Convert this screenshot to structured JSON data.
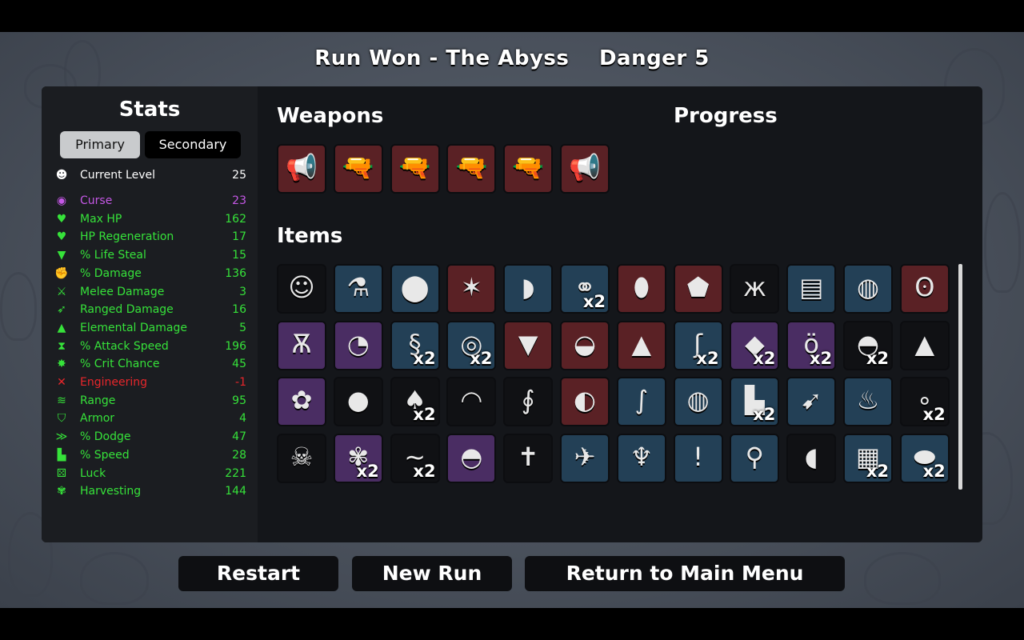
{
  "header": {
    "run_result": "Run Won - The Abyss",
    "danger": "Danger 5"
  },
  "stats": {
    "title": "Stats",
    "tabs": {
      "primary": "Primary",
      "secondary": "Secondary"
    },
    "rows": [
      {
        "icon": "level-up-icon",
        "glyph": "☻",
        "label": "Current Level",
        "value": "25",
        "color": "#ffffff"
      },
      {
        "icon": "curse-icon",
        "glyph": "◉",
        "label": "Curse",
        "value": "23",
        "color": "#c558e6"
      },
      {
        "icon": "heart-icon",
        "glyph": "♥",
        "label": "Max HP",
        "value": "162",
        "color": "#36e23a"
      },
      {
        "icon": "heart-plus-icon",
        "glyph": "♥",
        "label": "HP Regeneration",
        "value": "17",
        "color": "#36e23a"
      },
      {
        "icon": "fangs-icon",
        "glyph": "▼",
        "label": "% Life Steal",
        "value": "15",
        "color": "#36e23a"
      },
      {
        "icon": "muscle-icon",
        "glyph": "✊",
        "label": "% Damage",
        "value": "136",
        "color": "#36e23a"
      },
      {
        "icon": "sword-icon",
        "glyph": "⚔",
        "label": "Melee Damage",
        "value": "3",
        "color": "#36e23a"
      },
      {
        "icon": "bow-icon",
        "glyph": "➶",
        "label": "Ranged Damage",
        "value": "16",
        "color": "#36e23a"
      },
      {
        "icon": "flame-icon",
        "glyph": "▲",
        "label": "Elemental Damage",
        "value": "5",
        "color": "#36e23a"
      },
      {
        "icon": "hourglass-icon",
        "glyph": "⧗",
        "label": "% Attack Speed",
        "value": "196",
        "color": "#36e23a"
      },
      {
        "icon": "crit-star-icon",
        "glyph": "✸",
        "label": "% Crit Chance",
        "value": "45",
        "color": "#36e23a"
      },
      {
        "icon": "wrench-icon",
        "glyph": "✕",
        "label": "Engineering",
        "value": "-1",
        "color": "#e8262b"
      },
      {
        "icon": "range-waves-icon",
        "glyph": "≋",
        "label": "Range",
        "value": "95",
        "color": "#36e23a"
      },
      {
        "icon": "shield-icon",
        "glyph": "⛉",
        "label": "Armor",
        "value": "4",
        "color": "#36e23a"
      },
      {
        "icon": "dodge-wind-icon",
        "glyph": "≫",
        "label": "% Dodge",
        "value": "47",
        "color": "#36e23a"
      },
      {
        "icon": "boot-icon",
        "glyph": "▙",
        "label": "% Speed",
        "value": "28",
        "color": "#36e23a"
      },
      {
        "icon": "dice-icon",
        "glyph": "⚄",
        "label": "Luck",
        "value": "221",
        "color": "#36e23a"
      },
      {
        "icon": "wheat-icon",
        "glyph": "✾",
        "label": "Harvesting",
        "value": "144",
        "color": "#36e23a"
      }
    ]
  },
  "weapons": {
    "title": "Weapons",
    "slots": [
      {
        "name": "megaphone-icon",
        "glyph": "📢",
        "tier": "red"
      },
      {
        "name": "revolver-icon",
        "glyph": "🔫",
        "tier": "red"
      },
      {
        "name": "revolver-icon",
        "glyph": "🔫",
        "tier": "red"
      },
      {
        "name": "blunderbuss-icon",
        "glyph": "🔫",
        "tier": "red"
      },
      {
        "name": "blunderbuss-icon",
        "glyph": "🔫",
        "tier": "red"
      },
      {
        "name": "megaphone-icon",
        "glyph": "📢",
        "tier": "red"
      }
    ]
  },
  "progress": {
    "title": "Progress"
  },
  "items": {
    "title": "Items",
    "slots": [
      {
        "name": "mad-scientist-icon",
        "glyph": "☺",
        "tier": "black",
        "qty": ""
      },
      {
        "name": "potion-icon",
        "glyph": "⚗",
        "tier": "blue",
        "qty": ""
      },
      {
        "name": "bombs-icon",
        "glyph": "⬤",
        "tier": "blue",
        "qty": ""
      },
      {
        "name": "sparkler-icon",
        "glyph": "✶",
        "tier": "red",
        "qty": ""
      },
      {
        "name": "claw-icon",
        "glyph": "◗",
        "tier": "blue",
        "qty": ""
      },
      {
        "name": "chain-icon",
        "glyph": "⚭",
        "tier": "blue",
        "qty": "x2"
      },
      {
        "name": "potato-icon",
        "glyph": "⬮",
        "tier": "red",
        "qty": ""
      },
      {
        "name": "red-bag-icon",
        "glyph": "⬟",
        "tier": "red",
        "qty": ""
      },
      {
        "name": "butterfly-icon",
        "glyph": "ж",
        "tier": "black",
        "qty": ""
      },
      {
        "name": "armor-plate-icon",
        "glyph": "▤",
        "tier": "blue",
        "qty": ""
      },
      {
        "name": "cauldron-icon",
        "glyph": "◍",
        "tier": "blue",
        "qty": ""
      },
      {
        "name": "panda-icon",
        "glyph": "ʘ",
        "tier": "red",
        "qty": ""
      },
      {
        "name": "alien-head-icon",
        "glyph": "Ѫ",
        "tier": "purple",
        "qty": ""
      },
      {
        "name": "hermit-crab-icon",
        "glyph": "◔",
        "tier": "purple",
        "qty": ""
      },
      {
        "name": "larva-icon",
        "glyph": "§",
        "tier": "blue",
        "qty": "x2"
      },
      {
        "name": "lure-icon",
        "glyph": "◎",
        "tier": "blue",
        "qty": "x2"
      },
      {
        "name": "anvil-icon",
        "glyph": "▼",
        "tier": "red",
        "qty": ""
      },
      {
        "name": "shell-icon",
        "glyph": "◒",
        "tier": "red",
        "qty": ""
      },
      {
        "name": "wolf-head-icon",
        "glyph": "▲",
        "tier": "red",
        "qty": ""
      },
      {
        "name": "tentacle-icon",
        "glyph": "ʃ",
        "tier": "blue",
        "qty": "x2"
      },
      {
        "name": "crystal-icon",
        "glyph": "◆",
        "tier": "purple",
        "qty": "x2"
      },
      {
        "name": "cat-icon",
        "glyph": "ö",
        "tier": "purple",
        "qty": "x2"
      },
      {
        "name": "propeller-hat-icon",
        "glyph": "◓",
        "tier": "black",
        "qty": "x2"
      },
      {
        "name": "slime-icon",
        "glyph": "▲",
        "tier": "black",
        "qty": ""
      },
      {
        "name": "pink-brain-icon",
        "glyph": "✿",
        "tier": "purple",
        "qty": ""
      },
      {
        "name": "mummy-head-icon",
        "glyph": "●",
        "tier": "black",
        "qty": ""
      },
      {
        "name": "mushroom-icon",
        "glyph": "♠",
        "tier": "black",
        "qty": "x2"
      },
      {
        "name": "beanie-icon",
        "glyph": "◠",
        "tier": "black",
        "qty": ""
      },
      {
        "name": "seahorse-icon",
        "glyph": "∮",
        "tier": "black",
        "qty": ""
      },
      {
        "name": "stomach-icon",
        "glyph": "◐",
        "tier": "red",
        "qty": ""
      },
      {
        "name": "worm-icon",
        "glyph": "∫",
        "tier": "blue",
        "qty": ""
      },
      {
        "name": "pumpkin-icon",
        "glyph": "◍",
        "tier": "blue",
        "qty": ""
      },
      {
        "name": "boot-icon",
        "glyph": "▙",
        "tier": "blue",
        "qty": "x2"
      },
      {
        "name": "rocket-icon",
        "glyph": "➹",
        "tier": "blue",
        "qty": ""
      },
      {
        "name": "octopus-icon",
        "glyph": "♨",
        "tier": "blue",
        "qty": ""
      },
      {
        "name": "pearls-icon",
        "glyph": "∘",
        "tier": "black",
        "qty": "x2"
      },
      {
        "name": "skull-mask-icon",
        "glyph": "☠",
        "tier": "black",
        "qty": ""
      },
      {
        "name": "wheat-icon",
        "glyph": "✾",
        "tier": "purple",
        "qty": "x2"
      },
      {
        "name": "lizard-icon",
        "glyph": "~",
        "tier": "black",
        "qty": "x2"
      },
      {
        "name": "bowler-hat-icon",
        "glyph": "◓",
        "tier": "purple",
        "qty": ""
      },
      {
        "name": "voodoo-doll-icon",
        "glyph": "✝",
        "tier": "black",
        "qty": ""
      },
      {
        "name": "wasp-icon",
        "glyph": "✈",
        "tier": "blue",
        "qty": ""
      },
      {
        "name": "scarecrow-icon",
        "glyph": "♆",
        "tier": "blue",
        "qty": ""
      },
      {
        "name": "toxic-waste-icon",
        "glyph": "!",
        "tier": "blue",
        "qty": ""
      },
      {
        "name": "metal-detector-icon",
        "glyph": "⚲",
        "tier": "blue",
        "qty": ""
      },
      {
        "name": "whistle-icon",
        "glyph": "◖",
        "tier": "black",
        "qty": ""
      },
      {
        "name": "spring-icon",
        "glyph": "▦",
        "tier": "blue",
        "qty": "x2"
      },
      {
        "name": "stone-icon",
        "glyph": "⬬",
        "tier": "blue",
        "qty": "x2"
      }
    ]
  },
  "buttons": {
    "restart": "Restart",
    "new_run": "New Run",
    "main_menu": "Return to Main Menu"
  },
  "colors": {
    "tier_red": "#5a2125",
    "tier_blue": "#234056",
    "tier_black": "#101114",
    "tier_purple": "#4a2d63",
    "stat_green": "#36e23a",
    "stat_purple": "#c558e6",
    "stat_red": "#e8262b"
  }
}
